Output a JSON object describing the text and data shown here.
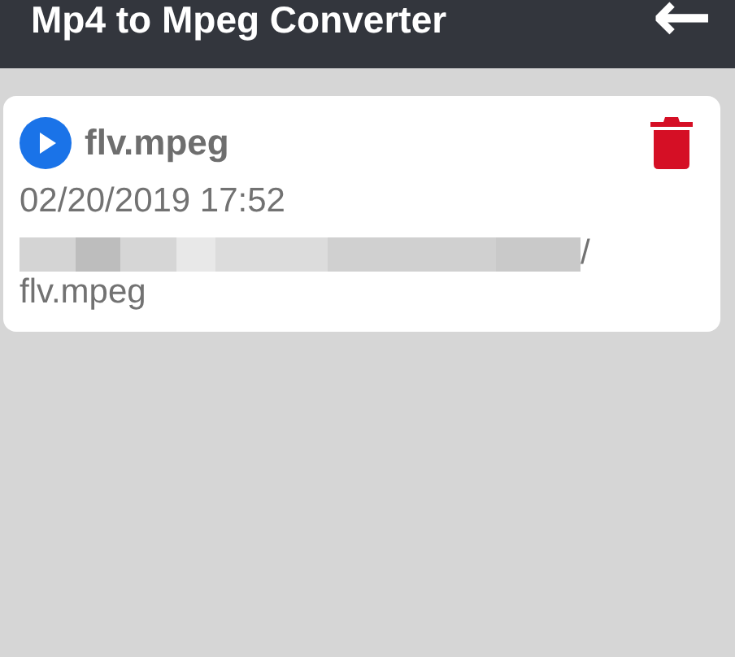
{
  "app_bar": {
    "title": "Mp4 to Mpeg Converter",
    "back_icon": "←"
  },
  "files": [
    {
      "name": "flv.mpeg",
      "date": "02/20/2019 17:52",
      "path_redacted": true,
      "path_tail": "/",
      "path_last_line": "flv.mpeg"
    }
  ]
}
